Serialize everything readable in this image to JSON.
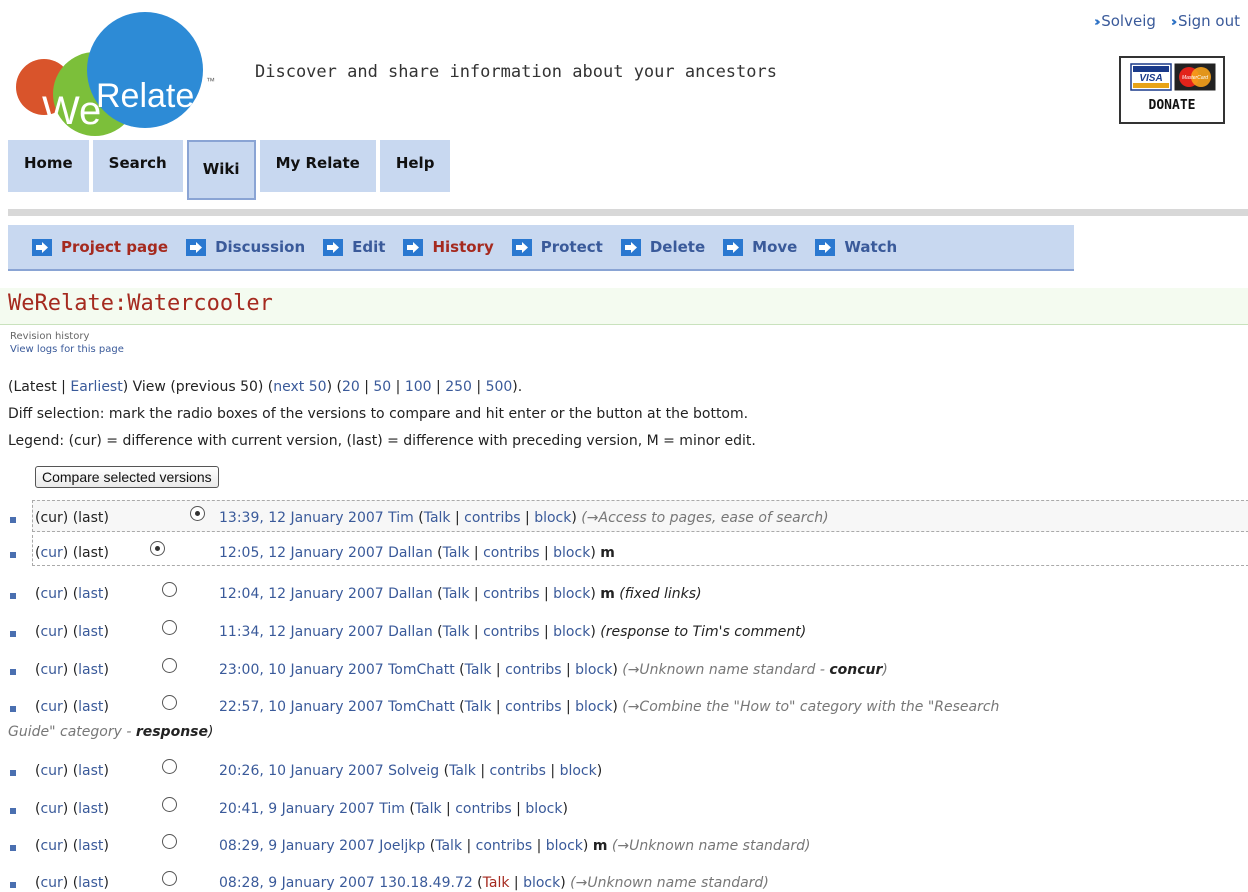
{
  "header": {
    "logo_text": "WeRelate",
    "logo_tm": "™",
    "tagline": "Discover and share information about your ancestors",
    "user_links": [
      "Solveig",
      "Sign out"
    ],
    "donate_label": "DONATE",
    "donate_cards": [
      "VISA",
      "MasterCard"
    ]
  },
  "main_nav": [
    {
      "label": "Home"
    },
    {
      "label": "Search"
    },
    {
      "label": "Wiki",
      "active": true
    },
    {
      "label": "My Relate"
    },
    {
      "label": "Help"
    }
  ],
  "actions": [
    {
      "label": "Project page",
      "current": true
    },
    {
      "label": "Discussion"
    },
    {
      "label": "Edit"
    },
    {
      "label": "History",
      "current": true
    },
    {
      "label": "Protect"
    },
    {
      "label": "Delete"
    },
    {
      "label": "Move"
    },
    {
      "label": "Watch"
    }
  ],
  "page": {
    "title": "WeRelate:Watercooler",
    "subtitle": "Revision history",
    "logs_link": "View logs for this page"
  },
  "navigation": {
    "latest": "Latest",
    "earliest": "Earliest",
    "view_prev": "View (previous 50)",
    "next": "next 50",
    "limits": [
      "20",
      "50",
      "100",
      "250",
      "500"
    ]
  },
  "diff_text": "Diff selection: mark the radio boxes of the versions to compare and hit enter or the button at the bottom.",
  "legend_text": "Legend: (cur) = difference with current version, (last) = difference with preceding version, M = minor edit.",
  "compare_button": "Compare selected versions",
  "labels": {
    "cur": "cur",
    "last": "last",
    "talk": "Talk",
    "contribs": "contribs",
    "block": "block",
    "minor": "m"
  },
  "revisions": [
    {
      "time": "13:39, 12 January 2007",
      "user": "Tim",
      "minor": false,
      "section": "→Access to pages, ease of search",
      "comment": ""
    },
    {
      "time": "12:05, 12 January 2007",
      "user": "Dallan",
      "minor": true,
      "section": "",
      "comment": ""
    },
    {
      "time": "12:04, 12 January 2007",
      "user": "Dallan",
      "minor": true,
      "section": "",
      "comment": "fixed links"
    },
    {
      "time": "11:34, 12 January 2007",
      "user": "Dallan",
      "minor": false,
      "section": "",
      "comment": "response to Tim's comment"
    },
    {
      "time": "23:00, 10 January 2007",
      "user": "TomChatt",
      "minor": false,
      "section": "→Unknown name standard",
      "comment": "concur"
    },
    {
      "time": "22:57, 10 January 2007",
      "user": "TomChatt",
      "minor": false,
      "section": "→Combine the \"How to\" category with the \"Research",
      "section_cont": "Guide\" category",
      "comment": "response"
    },
    {
      "time": "20:26, 10 January 2007",
      "user": "Solveig",
      "minor": false,
      "section": "",
      "comment": ""
    },
    {
      "time": "20:41, 9 January 2007",
      "user": "Tim",
      "minor": false,
      "section": "",
      "comment": ""
    },
    {
      "time": "08:29, 9 January 2007",
      "user": "Joeljkp",
      "minor": true,
      "section": "→Unknown name standard",
      "comment": ""
    },
    {
      "time": "08:28, 9 January 2007",
      "user": "130.18.49.72",
      "minor": false,
      "section": "→Unknown name standard",
      "comment": "",
      "anon": true
    }
  ],
  "colors": {
    "tab_bg": "#c8d8f0",
    "link": "#3a5a9a",
    "current_link": "#a52a1f",
    "title_bg": "#f4fbf0"
  }
}
